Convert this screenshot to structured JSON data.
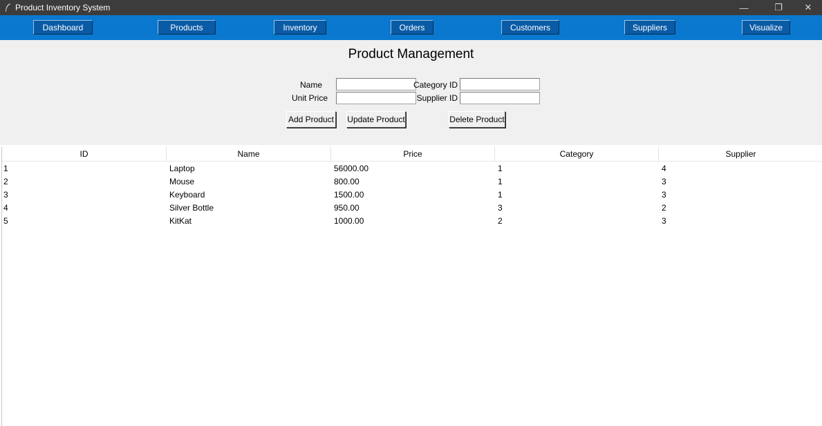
{
  "window": {
    "title": "Product Inventory System",
    "controls": {
      "minimize": "—",
      "maximize": "❐",
      "close": "✕"
    }
  },
  "colors": {
    "titlebar": "#3c3c3c",
    "navbar": "#0a78cf",
    "nav_button": "#0a5ba6",
    "form_background": "#f0f0f0"
  },
  "nav": {
    "items": [
      "Dashboard",
      "Products",
      "Inventory",
      "Orders",
      "Customers",
      "Suppliers",
      "Visualize"
    ]
  },
  "form": {
    "title": "Product Management",
    "name_label": "Name",
    "unit_price_label": "Unit Price",
    "category_id_label": "Category ID",
    "supplier_id_label": "Supplier ID",
    "name_value": "",
    "unit_price_value": "",
    "category_id_value": "",
    "supplier_id_value": "",
    "add_label": "Add Product",
    "update_label": "Update Product",
    "delete_label": "Delete Product"
  },
  "table": {
    "columns": [
      "ID",
      "Name",
      "Price",
      "Category",
      "Supplier"
    ],
    "rows": [
      [
        "1",
        "Laptop",
        "56000.00",
        "1",
        "4"
      ],
      [
        "2",
        "Mouse",
        "800.00",
        "1",
        "3"
      ],
      [
        "3",
        "Keyboard",
        "1500.00",
        "1",
        "3"
      ],
      [
        "4",
        "Silver Bottle",
        "950.00",
        "3",
        "2"
      ],
      [
        "5",
        "KitKat",
        "1000.00",
        "2",
        "3"
      ]
    ]
  }
}
